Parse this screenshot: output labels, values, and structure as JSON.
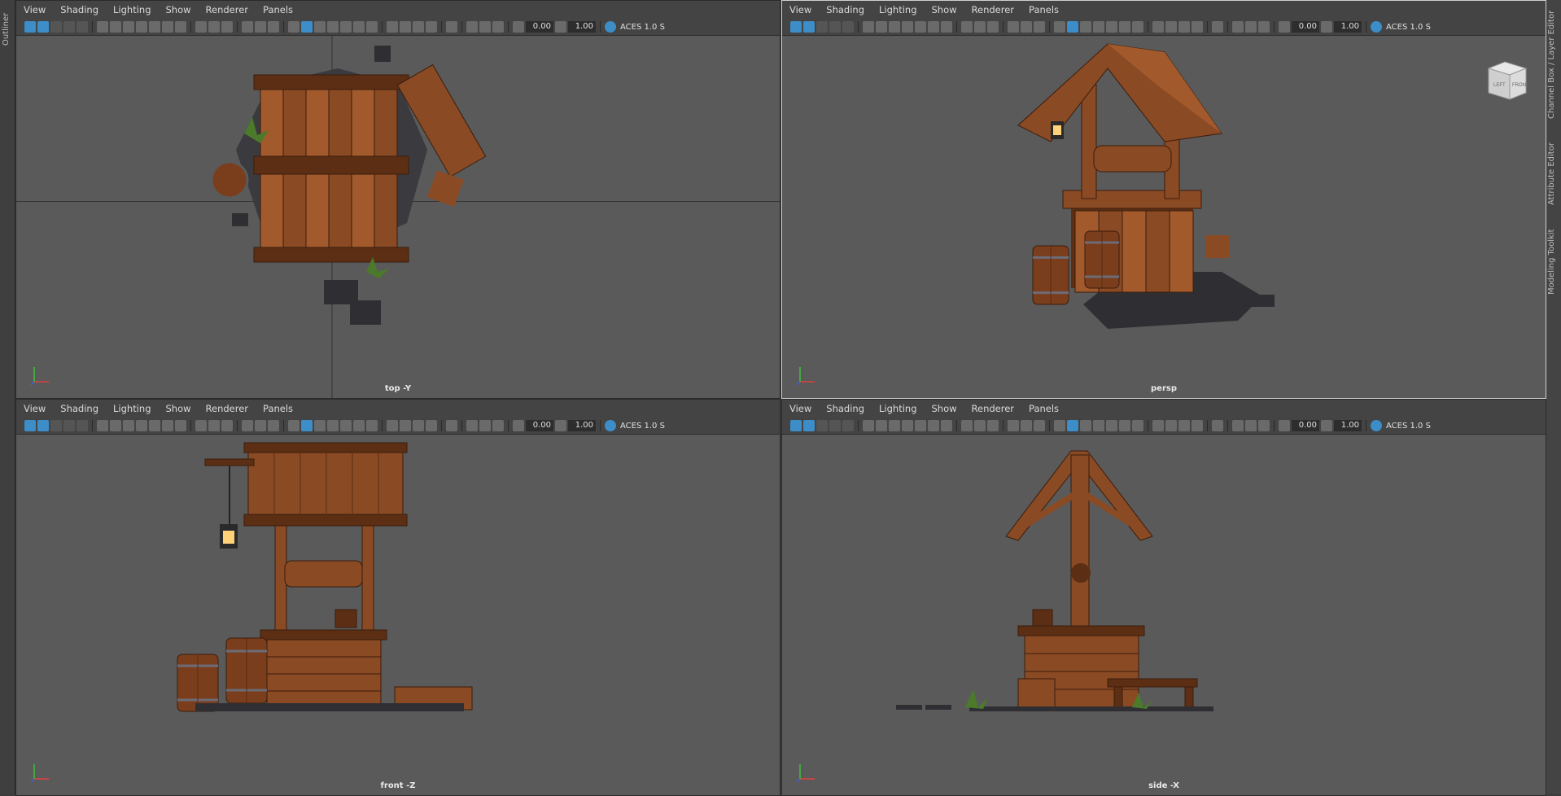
{
  "side_panels": {
    "left_tab": "Outliner",
    "right_tabs": [
      "Channel Box / Layer Editor",
      "Attribute Editor",
      "Modeling Toolkit"
    ]
  },
  "viewports": [
    {
      "id": "top",
      "menu": [
        "View",
        "Shading",
        "Lighting",
        "Show",
        "Renderer",
        "Panels"
      ],
      "value1": "0.00",
      "value2": "1.00",
      "color_space": "ACES 1.0 S",
      "camera": "top -Y",
      "active": false
    },
    {
      "id": "persp",
      "menu": [
        "View",
        "Shading",
        "Lighting",
        "Show",
        "Renderer",
        "Panels"
      ],
      "value1": "0.00",
      "value2": "1.00",
      "color_space": "ACES 1.0 S",
      "camera": "persp",
      "active": true,
      "viewcube": {
        "left": "LEFT",
        "front": "FRONT"
      }
    },
    {
      "id": "front",
      "menu": [
        "View",
        "Shading",
        "Lighting",
        "Show",
        "Renderer",
        "Panels"
      ],
      "value1": "0.00",
      "value2": "1.00",
      "color_space": "ACES 1.0 S",
      "camera": "front -Z",
      "active": false
    },
    {
      "id": "side",
      "menu": [
        "View",
        "Shading",
        "Lighting",
        "Show",
        "Renderer",
        "Panels"
      ],
      "value1": "0.00",
      "value2": "1.00",
      "color_space": "ACES 1.0 S",
      "camera": "side -X",
      "active": false
    }
  ],
  "axis_labels": {
    "x": "x",
    "y": "y",
    "z": "z"
  },
  "colors": {
    "viewport_bg": "#5a5a5a",
    "wood": "#8a4a24",
    "wood_dark": "#5c2f15",
    "stone": "#2f2f33",
    "accent": "#3c8dc8"
  }
}
